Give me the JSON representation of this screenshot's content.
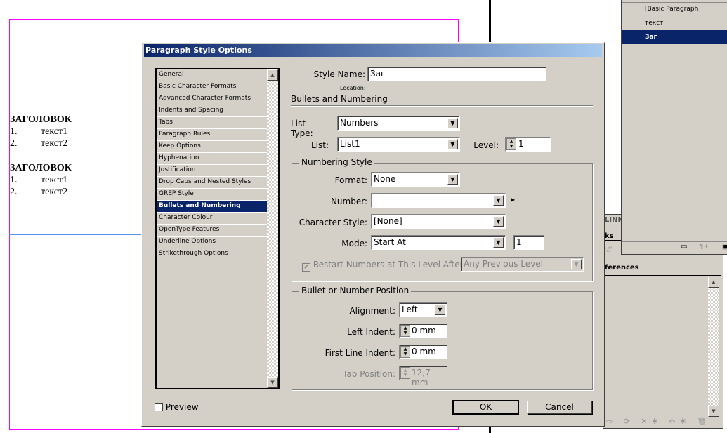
{
  "document": {
    "blocks": [
      {
        "heading": "ЗАГОЛОВОК",
        "items": [
          {
            "num": "1.",
            "text": "текст1"
          },
          {
            "num": "2.",
            "text": "текст2"
          }
        ]
      },
      {
        "heading": "ЗАГОЛОВОК",
        "items": [
          {
            "num": "1.",
            "text": "текст1"
          },
          {
            "num": "2.",
            "text": "текст2"
          }
        ]
      }
    ]
  },
  "styles_panel": {
    "items": [
      "[Basic Paragraph]",
      "текст",
      "Заг"
    ],
    "selected": "Заг"
  },
  "links_panel": {
    "tab": "LINK",
    "row1": "ks",
    "row2": "://",
    "section": "ferences"
  },
  "dialog": {
    "title": "Paragraph Style Options",
    "categories": [
      "General",
      "Basic Character Formats",
      "Advanced Character Formats",
      "Indents and Spacing",
      "Tabs",
      "Paragraph Rules",
      "Keep Options",
      "Hyphenation",
      "Justification",
      "Drop Caps and Nested Styles",
      "GREP Style",
      "Bullets and Numbering",
      "Character Colour",
      "OpenType Features",
      "Underline Options",
      "Strikethrough Options"
    ],
    "selected_category": "Bullets and Numbering",
    "style_name_label": "Style Name:",
    "style_name": "Заг",
    "location_label": "Location:",
    "section_title": "Bullets and Numbering",
    "list_type_label": "List Type:",
    "list_type": "Numbers",
    "list_label": "List:",
    "list": "List1",
    "level_label": "Level:",
    "level": "1",
    "numbering_style": {
      "title": "Numbering Style",
      "format_label": "Format:",
      "format": "None",
      "number_label": "Number:",
      "number": "",
      "char_style_label": "Character Style:",
      "char_style": "[None]",
      "mode_label": "Mode:",
      "mode": "Start At",
      "start_at": "1",
      "restart_label": "Restart Numbers at This Level After",
      "restart_checked": true,
      "restart_value": "Any Previous Level"
    },
    "position": {
      "title": "Bullet or Number Position",
      "alignment_label": "Alignment:",
      "alignment": "Left",
      "left_indent_label": "Left Indent:",
      "left_indent": "0 mm",
      "first_line_label": "First Line Indent:",
      "first_line": "0 mm",
      "tab_label": "Tab Position:",
      "tab": "12,7 mm"
    },
    "preview_label": "Preview",
    "ok": "OK",
    "cancel": "Cancel"
  }
}
